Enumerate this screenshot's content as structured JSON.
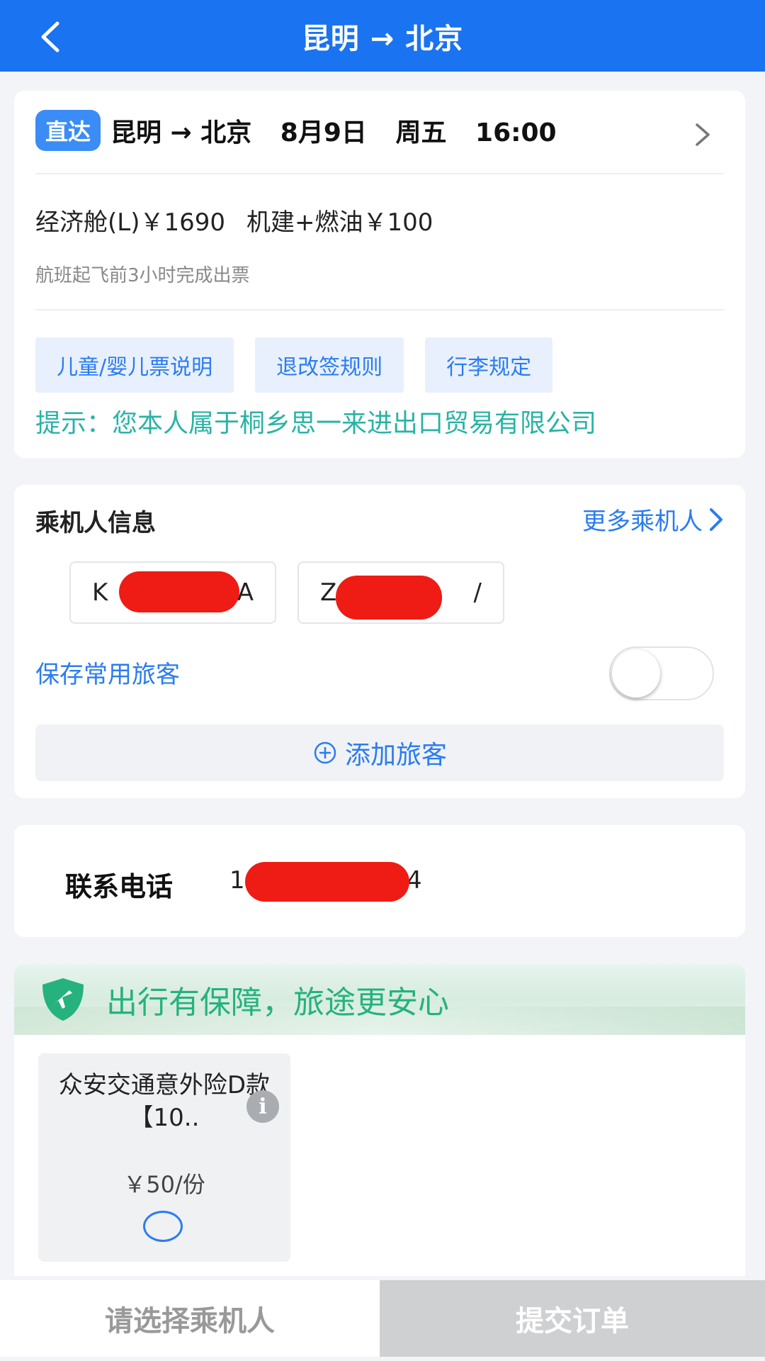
{
  "header": {
    "title": "昆明 → 北京"
  },
  "flight": {
    "badge": "直达",
    "route": "昆明 → 北京",
    "date": "8月9日",
    "weekday": "周五",
    "time": "16:00",
    "cabin_price": "经济舱(L)￥1690",
    "tax_price": "机建+燃油￥100",
    "ticket_note": "航班起飞前3小时完成出票",
    "buttons": [
      "儿童/婴儿票说明",
      "退改签规则",
      "行李规定"
    ],
    "tip": "提示：您本人属于桐乡思一来进出口贸易有限公司"
  },
  "passengers": {
    "title": "乘机人信息",
    "more_label": "更多乘机人",
    "chips": [
      {
        "prefix": "K",
        "suffix": "A"
      },
      {
        "prefix": "Z",
        "suffix": "/"
      }
    ],
    "save_label": "保存常用旅客",
    "add_label": "添加旅客"
  },
  "contact": {
    "label": "联系电话",
    "value_prefix": "1",
    "value_suffix": "4"
  },
  "insurance": {
    "banner_title": "出行有保障，旅途更安心",
    "items": [
      {
        "name": "众安交通意外险D款【10..",
        "price": "￥50/份"
      }
    ]
  },
  "bottom_bar": {
    "select_label": "请选择乘机人",
    "submit_label": "提交订单"
  },
  "colors": {
    "accent": "#1a73f0",
    "tip": "#2ab3a5",
    "insurance": "#25b27f",
    "redaction": "#ee1c14"
  }
}
